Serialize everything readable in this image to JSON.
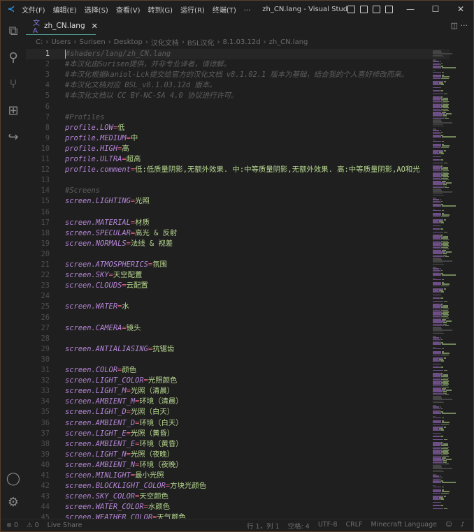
{
  "titlebar": {
    "menu": [
      "文件(F)",
      "编辑(E)",
      "选择(S)",
      "查看(V)",
      "转到(G)",
      "运行(R)",
      "终端(T)",
      "···"
    ],
    "title": "zh_CN.lang - Visual Studio...",
    "minimize": "—",
    "maximize": "☐",
    "close": "✕"
  },
  "tab": {
    "icon": "文A",
    "label": "zh_CN.lang",
    "close": "✕",
    "actions": "◫  ···"
  },
  "breadcrumb": [
    "C:",
    "Users",
    "Surisen",
    "Desktop",
    "汉化文档",
    "BSL汉化",
    "8.1.03.12d",
    "zh_CN.lang"
  ],
  "breadcrumb_sep": "›",
  "colors": {
    "key": "#b586d8",
    "equals": "#e0607e",
    "value": "#b6d68f",
    "comment": "#5e5e5e",
    "background": "#1f1f1f",
    "caret": "#e6b800"
  },
  "editor": {
    "lines": [
      {
        "n": "1",
        "c": "#shaders/lang/zh_CN.lang"
      },
      {
        "n": "2",
        "c": "#本汉化由Surisen提供，并非专业译者，请谅解。"
      },
      {
        "n": "3",
        "c": "#本汉化根据kaniol-Lck提交给官方的汉化文档 v8.1.02.1 版本为基础，结合我的个人喜好修改而来。"
      },
      {
        "n": "4",
        "c": "#本汉化文档对应 BSL_v8.1.03.12d 版本。"
      },
      {
        "n": "5",
        "c": "#本汉化文档以 CC BY-NC-SA 4.0 协议进行许可。"
      },
      {
        "n": "6"
      },
      {
        "n": "7",
        "c": "#Profiles"
      },
      {
        "n": "8",
        "k": "profile.LOW",
        "v": "低"
      },
      {
        "n": "9",
        "k": "profile.MEDIUM",
        "v": "中"
      },
      {
        "n": "10",
        "k": "profile.HIGH",
        "v": "高"
      },
      {
        "n": "11",
        "k": "profile.ULTRA",
        "v": "超高"
      },
      {
        "n": "12",
        "k": "profile.comment",
        "v": "低:低质量阴影,无额外效果. 中:中等质量阴影,无额外效果. 高:中等质量阴影,AO和光"
      },
      {
        "n": "13"
      },
      {
        "n": "14",
        "c": "#Screens"
      },
      {
        "n": "15",
        "k": "screen.LIGHTING",
        "v": "光照"
      },
      {
        "n": "16"
      },
      {
        "n": "17",
        "k": "screen.MATERIAL",
        "v": "材质"
      },
      {
        "n": "18",
        "k": "screen.SPECULAR",
        "v": "高光 & 反射"
      },
      {
        "n": "19",
        "k": "screen.NORMALS",
        "v": "法线 & 视差"
      },
      {
        "n": "20"
      },
      {
        "n": "21",
        "k": "screen.ATMOSPHERICS",
        "v": "氛围"
      },
      {
        "n": "22",
        "k": "screen.SKY",
        "v": "天空配置"
      },
      {
        "n": "23",
        "k": "screen.CLOUDS",
        "v": "云配置"
      },
      {
        "n": "24"
      },
      {
        "n": "25",
        "k": "screen.WATER",
        "v": "水"
      },
      {
        "n": "26"
      },
      {
        "n": "27",
        "k": "screen.CAMERA",
        "v": "镜头"
      },
      {
        "n": "28"
      },
      {
        "n": "29",
        "k": "screen.ANTIALIASING",
        "v": "抗锯齿"
      },
      {
        "n": "30"
      },
      {
        "n": "31",
        "k": "screen.COLOR",
        "v": "颜色"
      },
      {
        "n": "32",
        "k": "screen.LIGHT_COLOR",
        "v": "光照颜色"
      },
      {
        "n": "33",
        "k": "screen.LIGHT_M",
        "v": "光照（清晨）"
      },
      {
        "n": "34",
        "k": "screen.AMBIENT_M",
        "v": "环境（清晨）"
      },
      {
        "n": "35",
        "k": "screen.LIGHT_D",
        "v": "光照（白天）"
      },
      {
        "n": "36",
        "k": "screen.AMBIENT_D",
        "v": "环境（白天）"
      },
      {
        "n": "37",
        "k": "screen.LIGHT_E",
        "v": "光照（黄昏）"
      },
      {
        "n": "38",
        "k": "screen.AMBIENT_E",
        "v": "环境（黄昏）"
      },
      {
        "n": "39",
        "k": "screen.LIGHT_N",
        "v": "光照（夜晚）"
      },
      {
        "n": "40",
        "k": "screen.AMBIENT_N",
        "v": "环境（夜晚）"
      },
      {
        "n": "41",
        "k": "screen.MINLIGHT",
        "v": "最小光照"
      },
      {
        "n": "42",
        "k": "screen.BLOCKLIGHT_COLOR",
        "v": "方块光颜色"
      },
      {
        "n": "43",
        "k": "screen.SKY_COLOR",
        "v": "天空颜色"
      },
      {
        "n": "44",
        "k": "screen.WATER_COLOR",
        "v": "水颜色"
      },
      {
        "n": "45",
        "k": "screen.WEATHER COLOR",
        "v": "天气颜色"
      }
    ]
  },
  "status": {
    "errors": "⊗ 0",
    "warnings": "⚠ 0",
    "live_share": "Live Share",
    "position": "行 1，列 1",
    "spaces": "空格: 4",
    "encoding": "UTF-8",
    "eol": "CRLF",
    "language": "Minecraft Language"
  }
}
